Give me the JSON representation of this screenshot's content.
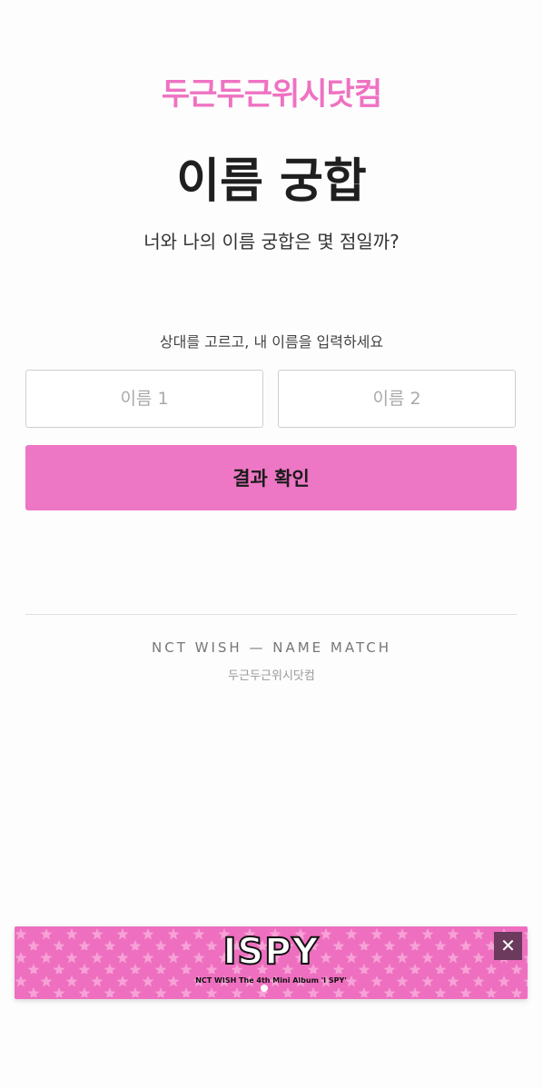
{
  "header": {
    "brand": "두근두근위시닷컴",
    "title": "이름 궁합",
    "subtitle": "너와 나의 이름 궁합은 몇 점일까?"
  },
  "form": {
    "instruction": "상대를 고르고, 내 이름을 입력하세요",
    "name1_placeholder": "이름 1",
    "name2_placeholder": "이름 2",
    "submit_label": "결과 확인"
  },
  "footer": {
    "tagline": "NCT WISH — NAME MATCH",
    "brand": "두근두근위시닷컴"
  },
  "banner": {
    "logo_text": "ISPY",
    "sub_text": "NCT WISH The 4th Mini Album 'I SPY'",
    "close_label": "✕",
    "close_icon": "close-icon",
    "background_color": "#ee6fbf"
  },
  "colors": {
    "accent": "#ef72c2",
    "button": "#ed77c4"
  }
}
